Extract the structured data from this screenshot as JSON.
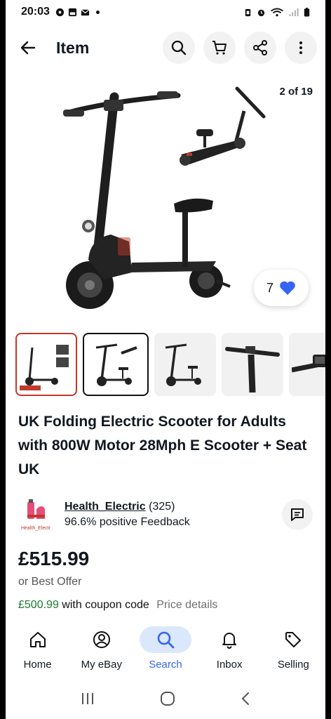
{
  "status_bar": {
    "time": "20:03"
  },
  "header": {
    "title": "Item"
  },
  "gallery": {
    "counter": "2 of 19",
    "watch_count": "7",
    "thumbnail_count": 5
  },
  "product": {
    "title": "UK Folding Electric Scooter for Adults with 800W Motor 28Mph E Scooter + Seat UK"
  },
  "seller": {
    "name": "Health_Electric",
    "rating_count": "(325)",
    "feedback": "96.6% positive Feedback",
    "logo_text": "Health_Electr"
  },
  "pricing": {
    "price": "£515.99",
    "offer": "or Best Offer",
    "coupon_price": "£500.99",
    "coupon_text": "with coupon code",
    "price_details": "Price details"
  },
  "bottom_nav": [
    {
      "label": "Home",
      "icon": "home-icon"
    },
    {
      "label": "My eBay",
      "icon": "user-icon"
    },
    {
      "label": "Search",
      "icon": "search-icon",
      "active": true
    },
    {
      "label": "Inbox",
      "icon": "bell-icon"
    },
    {
      "label": "Selling",
      "icon": "tag-icon"
    }
  ],
  "colors": {
    "accent": "#3665f3",
    "heart": "#3665f3",
    "coupon": "#1b7a2e",
    "active_nav_bg": "#dbe8fb"
  }
}
